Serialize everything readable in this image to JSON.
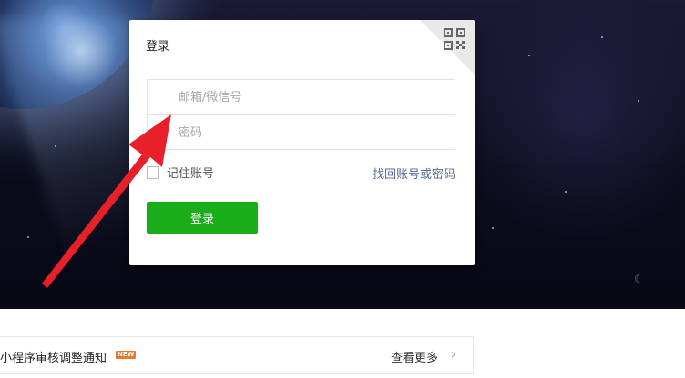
{
  "login_card": {
    "title": "登录",
    "qr_icon": "qr-code-icon",
    "account_placeholder": "邮箱/微信号",
    "password_placeholder": "密码",
    "remember_label": "记住账号",
    "forgot_link": "找回账号或密码",
    "submit_label": "登录"
  },
  "notice": {
    "text": "小程序审核调整通知",
    "badge": "NEW",
    "more_label": "查看更多",
    "chevron_icon": "chevron-right-icon"
  },
  "colors": {
    "primary_button": "#1aad19",
    "link": "#576b95",
    "annotation_arrow": "#e8202a",
    "badge": "#e8782a"
  }
}
